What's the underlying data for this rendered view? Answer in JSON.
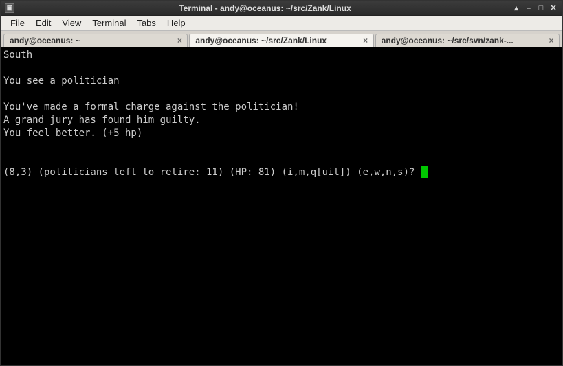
{
  "window": {
    "title": "Terminal - andy@oceanus: ~/src/Zank/Linux"
  },
  "menu": {
    "file": "File",
    "edit": "Edit",
    "view": "View",
    "terminal": "Terminal",
    "tabs": "Tabs",
    "help": "Help"
  },
  "tabs": [
    {
      "label": "andy@oceanus: ~",
      "active": false
    },
    {
      "label": "andy@oceanus: ~/src/Zank/Linux",
      "active": true
    },
    {
      "label": "andy@oceanus: ~/src/svn/zank-...",
      "active": false
    }
  ],
  "terminal": {
    "lines": [
      "South",
      "",
      "You see a politician",
      "",
      "You've made a formal charge against the politician!",
      "A grand jury has found him guilty.",
      "You feel better. (+5 hp)",
      "",
      ""
    ],
    "prompt": "(8,3) (politicians left to retire: 11) (HP: 81) (i,m,q[uit]) (e,w,n,s)? "
  }
}
